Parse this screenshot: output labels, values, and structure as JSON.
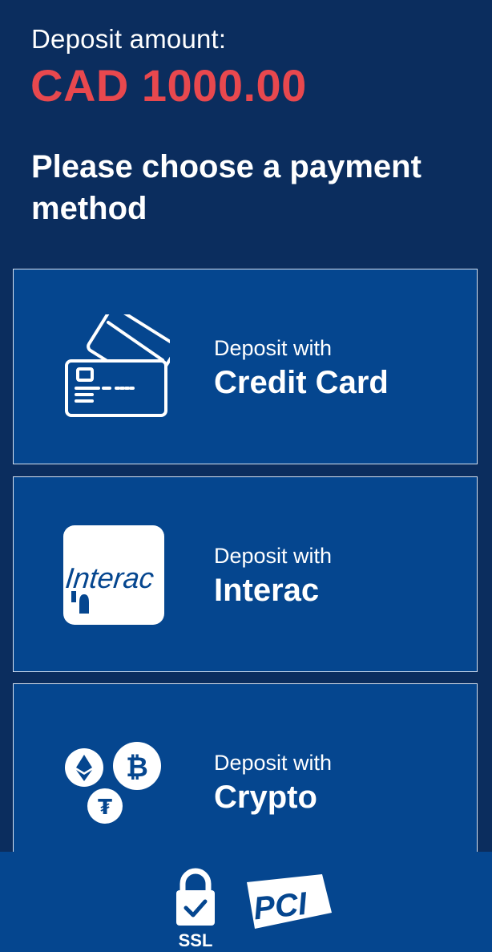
{
  "header": {
    "deposit_label": "Deposit amount:",
    "deposit_amount": "CAD 1000.00",
    "heading": "Please choose a payment method"
  },
  "methods": [
    {
      "sub": "Deposit with",
      "main": "Credit Card",
      "icon": "credit-card-icon"
    },
    {
      "sub": "Deposit with",
      "main": "Interac",
      "icon": "interac-logo"
    },
    {
      "sub": "Deposit with",
      "main": "Crypto",
      "icon": "crypto-icon"
    }
  ],
  "footer": {
    "ssl_label": "SSL",
    "pci_label": "PCI"
  },
  "colors": {
    "background": "#0b2d5e",
    "card": "#05468f",
    "amount": "#e8484e"
  }
}
